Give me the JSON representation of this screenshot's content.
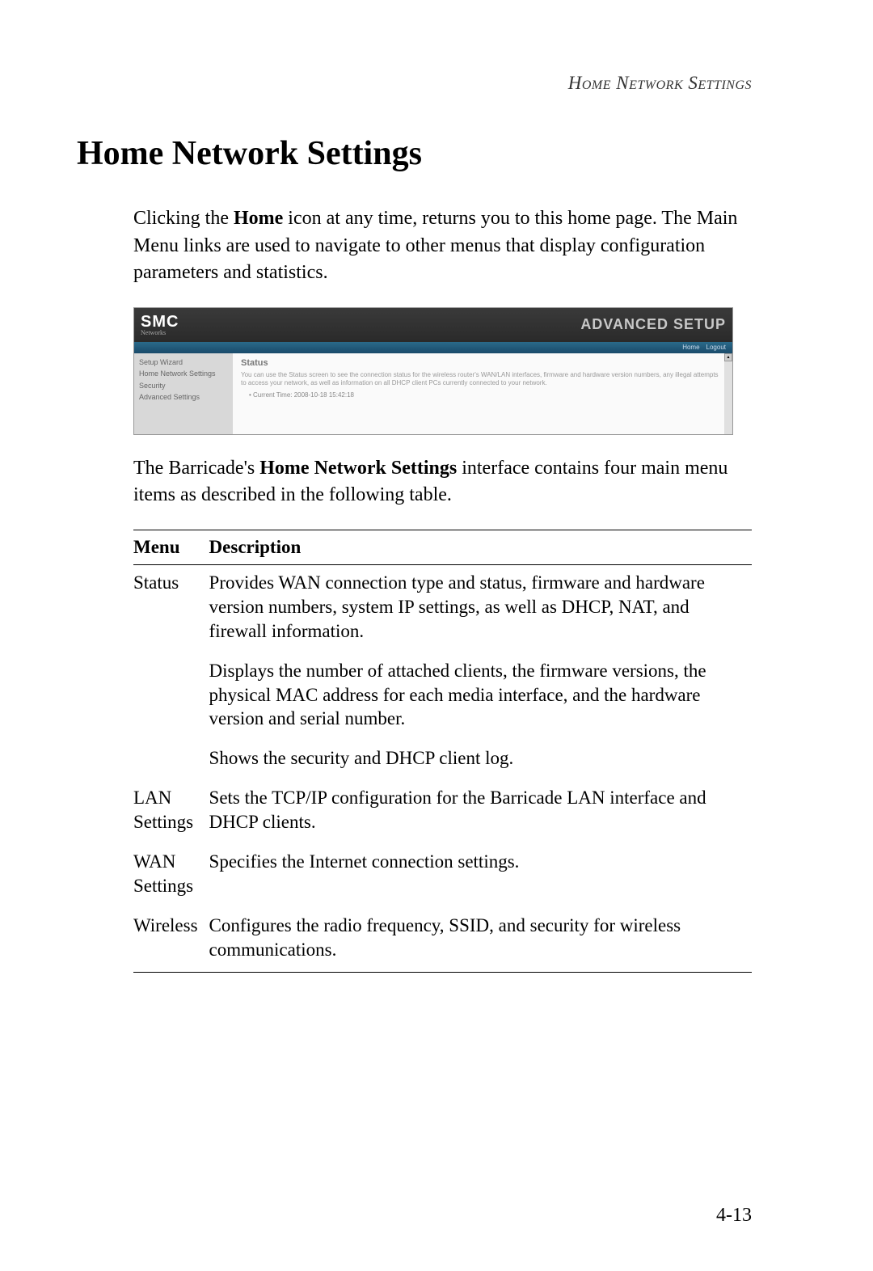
{
  "running_header": "Home Network Settings",
  "heading": "Home Network Settings",
  "intro_prefix": "Clicking the ",
  "intro_bold": "Home",
  "intro_suffix": " icon at any time, returns you to this home page. The Main Menu links are used to navigate to other menus that display configuration parameters and statistics.",
  "screenshot": {
    "logo": "SMC",
    "logo_sub": "Networks",
    "title": "ADVANCED SETUP",
    "tabs": {
      "home": "Home",
      "logout": "Logout"
    },
    "sidebar": {
      "setup_wizard": "Setup Wizard",
      "home_network": "Home Network Settings",
      "security": "Security",
      "advanced": "Advanced Settings"
    },
    "content": {
      "title": "Status",
      "description": "You can use the Status screen to see the connection status for the wireless router's WAN/LAN interfaces, firmware and hardware version numbers, any illegal attempts to access your network, as well as information on all DHCP client PCs currently connected to your network.",
      "bullet": "Current Time: 2008-10-18 15:42:18"
    }
  },
  "mid_para_prefix": "The Barricade's ",
  "mid_para_bold": "Home Network Settings",
  "mid_para_suffix": " interface contains four main menu items as described in the following table.",
  "table": {
    "headers": {
      "menu": "Menu",
      "description": "Description"
    },
    "rows": [
      {
        "menu": "Status",
        "desc": "Provides WAN connection type and status, firmware and hardware version numbers, system IP settings, as well as DHCP, NAT, and firewall information."
      },
      {
        "menu": "",
        "desc": "Displays the number of attached clients, the firmware versions, the physical MAC address for each media interface, and the hardware version and serial number."
      },
      {
        "menu": "",
        "desc": "Shows the security and DHCP client log."
      },
      {
        "menu": "LAN Settings",
        "desc": "Sets the TCP/IP configuration for the Barricade LAN interface and DHCP clients."
      },
      {
        "menu": "WAN Settings",
        "desc": "Specifies the Internet connection settings."
      },
      {
        "menu": "Wireless",
        "desc": "Configures the radio frequency, SSID, and security for wireless communications."
      }
    ]
  },
  "page_number": "4-13"
}
